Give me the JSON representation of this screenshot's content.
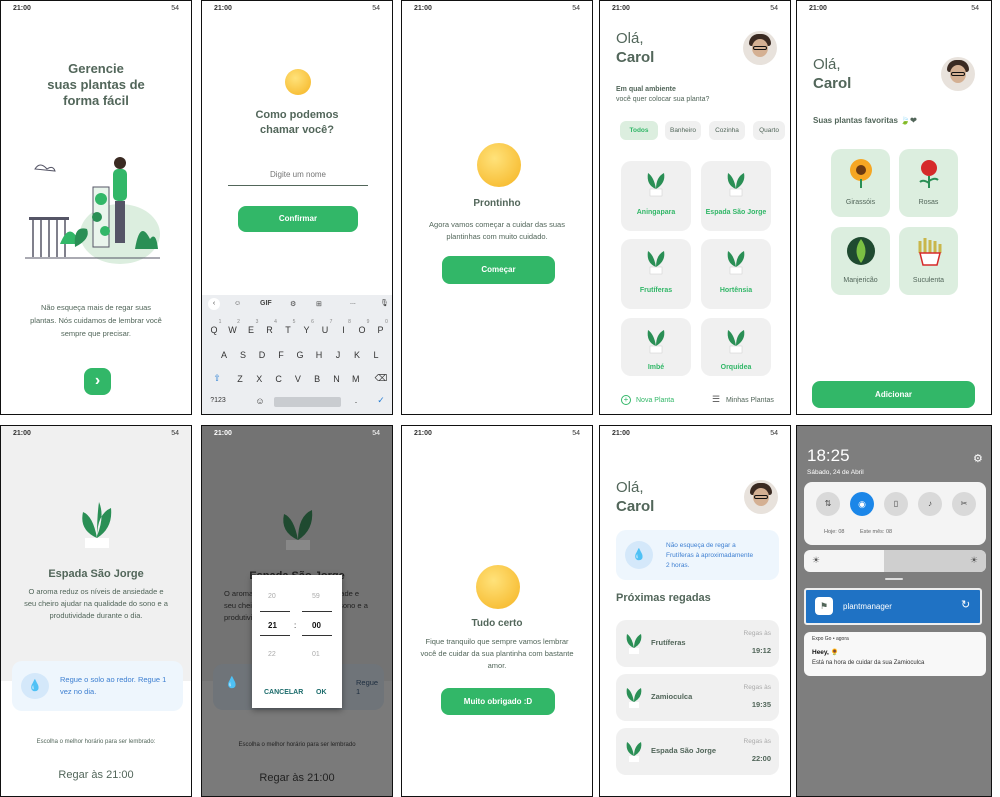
{
  "status": {
    "time": "21:00",
    "battery": "54"
  },
  "s1": {
    "title": [
      "Gerencie",
      "suas plantas de",
      "forma fácil"
    ],
    "body": [
      "Não esqueça mais de regar suas",
      "plantas. Nós cuidamos de lembrar você",
      "sempre que precisar."
    ],
    "btn": "›"
  },
  "s2": {
    "title": [
      "Como podemos",
      "chamar você?"
    ],
    "placeholder": "Digite um nome",
    "confirm": "Confirmar",
    "kb_top": [
      "GIF",
      "..."
    ],
    "row1": [
      "Q",
      "W",
      "E",
      "R",
      "T",
      "Y",
      "U",
      "I",
      "O",
      "P"
    ],
    "nums": [
      "1",
      "2",
      "3",
      "4",
      "5",
      "6",
      "7",
      "8",
      "9",
      "0"
    ],
    "row2": [
      "A",
      "S",
      "D",
      "F",
      "G",
      "H",
      "J",
      "K",
      "L"
    ],
    "row3": [
      "Z",
      "X",
      "C",
      "V",
      "B",
      "N",
      "M"
    ],
    "mode": "?123"
  },
  "s3": {
    "title": "Prontinho",
    "body": [
      "Agora vamos começar a cuidar das suas",
      "plantinhas com muito cuidado."
    ],
    "btn": "Começar"
  },
  "s4": {
    "hello": "Olá,",
    "name": "Carol",
    "q1": "Em qual ambiente",
    "q2": "você quer colocar sua planta?",
    "filters": [
      "Todos",
      "Banheiro",
      "Cozinha",
      "Quarto"
    ],
    "plants": [
      "Aningapara",
      "Espada São Jorge",
      "Frutíferas",
      "Hortênsia",
      "Imbé",
      "Orquídea"
    ],
    "nav_new": "Nova Planta",
    "nav_mine": "Minhas Plantas"
  },
  "s5": {
    "hello": "Olá,",
    "name": "Carol",
    "fav": "Suas plantas favoritas 🍃❤",
    "items": [
      "Girassóis",
      "Rosas",
      "Manjericão",
      "Suculenta"
    ],
    "btn": "Adicionar"
  },
  "s6": {
    "name": "Espada São Jorge",
    "desc": [
      "O aroma reduz os níveis de ansiedade e",
      "seu cheiro ajudar na qualidade do sono e a",
      "produtividade durante o dia."
    ],
    "tip": [
      "Regue o solo ao redor. Regue 1",
      "vez no dia."
    ],
    "choose": "Escolha o melhor horário para ser lembrado:",
    "time": "Regar às 21:00"
  },
  "s7": {
    "name": "Espada São Jorge",
    "desc": [
      "O aroma reduz os níveis de ansiedade e",
      "seu cheiro ajudar na qualidade do sono e a",
      "produtividade durante o dia."
    ],
    "tip": "Regue 1",
    "choose": "Escolha o melhor horário para ser lembrado",
    "time": "Regar às 21:00",
    "h": [
      "20",
      "21",
      "22"
    ],
    "m": [
      "59",
      "00",
      "01"
    ],
    "cancel": "CANCELAR",
    "ok": "OK"
  },
  "s8": {
    "title": "Tudo certo",
    "body": [
      "Fique tranquilo que sempre vamos lembrar",
      "você de cuidar da sua plantinha com bastante",
      "amor."
    ],
    "btn": "Muito obrigado :D"
  },
  "s9": {
    "hello": "Olá,",
    "name": "Carol",
    "banner": [
      "Não esqueça de regar a",
      "Frutíferas à aproximadamente",
      "2 horas."
    ],
    "next": "Próximas regadas",
    "rows": [
      {
        "n": "Frutíferas",
        "l": "Regas às",
        "t": "19:12"
      },
      {
        "n": "Zamioculca",
        "l": "Regas às",
        "t": "19:35"
      },
      {
        "n": "Espada São Jorge",
        "l": "Regas às",
        "t": "22:00"
      }
    ]
  },
  "s10": {
    "clock": "18:25",
    "date": "Sábado, 24 de Abril",
    "today": "Hoje: 08",
    "month": "Este mês: 08",
    "app": "plantmanager",
    "src": "Expo Go • agora",
    "heey": "Heey, 🌻",
    "msg": "Está na hora de cuidar da sua Zamioculca"
  }
}
